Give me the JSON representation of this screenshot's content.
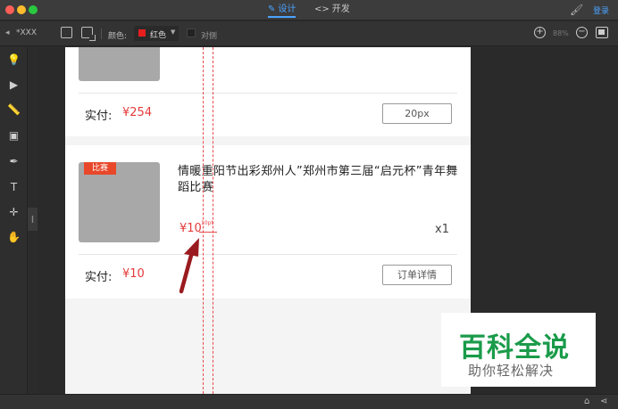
{
  "titlebar": {
    "tabs": [
      {
        "label": "设计",
        "icon": "pencil-icon"
      },
      {
        "label": "开发",
        "icon": "code-icon"
      }
    ],
    "login": "登录"
  },
  "toolbar": {
    "file_name": "*XXX",
    "color_label": "颜色:",
    "color_value": "红色",
    "color_hex": "#e81e1e",
    "align_label": "对侧",
    "zoom": "88%"
  },
  "sidebar": {
    "tools": [
      "bulb-icon",
      "pointer-icon",
      "ruler-icon",
      "frame-icon",
      "eyedropper-icon",
      "text-icon",
      "crosshair-icon",
      "hand-icon"
    ]
  },
  "canvas": {
    "top_order": {
      "pay_label": "实付:",
      "pay_amount": "¥254",
      "button": "20px"
    },
    "order": {
      "badge": "比赛",
      "title": "情暖重阳节出彩郑州人”郑州市第三届“启元杯”青年舞蹈比赛",
      "price": "¥10",
      "quantity": "x1",
      "pay_label": "实付:",
      "pay_amount": "¥10",
      "button": "订单详情"
    },
    "measure_label": "10pt"
  },
  "watermark": {
    "title": "百科全说",
    "subtitle": "助你轻松解决"
  },
  "colors": {
    "accent": "#4aa3ff",
    "price": "#e33a3a",
    "badge": "#e8472a",
    "watermark_green": "#1a9b4a"
  }
}
